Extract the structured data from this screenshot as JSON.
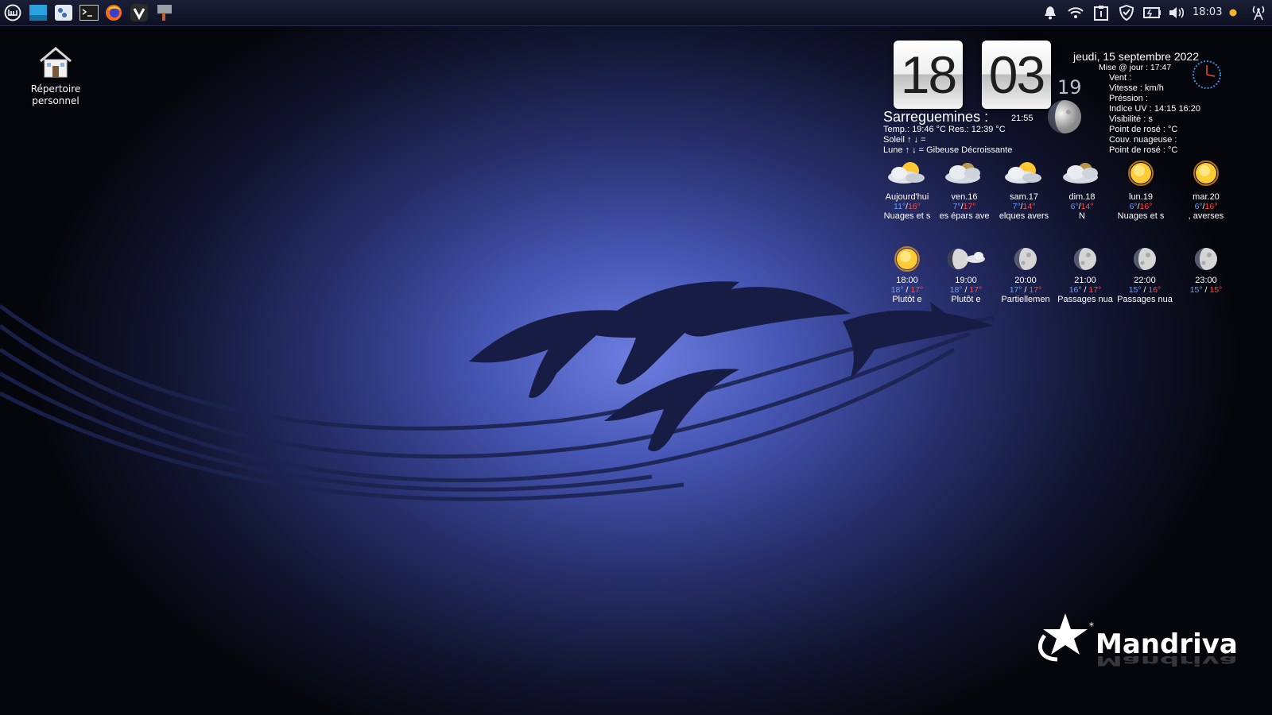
{
  "panel": {
    "launchers": [
      "mint-menu-icon",
      "show-desktop-icon",
      "settings-icon",
      "terminal-icon",
      "firefox-icon",
      "vivaldi-icon",
      "app-icon"
    ],
    "tray": [
      "bell-icon",
      "wifi-icon",
      "clipboard-icon",
      "shield-icon",
      "battery-icon",
      "volume-icon"
    ],
    "clock": "18:03"
  },
  "desktop": {
    "home_label_1": "Répertoire",
    "home_label_2": "personnel"
  },
  "widget": {
    "hour": "18",
    "minute": "03",
    "seconds": "19",
    "date": "jeudi, 15 septembre 2022",
    "update": "Mise @ jour : 17:47",
    "city": "Sarreguemines :",
    "city_time": "21:55",
    "temp_line": "Temp.: 19:46 °C   Res.: 12:39 °C",
    "sun_line": "Soleil ↑  ↓  =",
    "moon_line": "Lune  ↑  ↓  =  Gibeuse Décroissante",
    "stats": [
      "Vent :",
      "Vitesse :  km/h",
      "Préssion :",
      "Indice UV : 14:15 16:20",
      "Visibilité  : s",
      "Point de rosé :  °C",
      "Couv. nuageuse :",
      "Point de rosé :  °C"
    ],
    "daily": [
      {
        "label": "Aujourd'hui",
        "lo": "11°",
        "hi": "16°",
        "desc": "Nuages et s",
        "icon": "partly-cloudy-icon"
      },
      {
        "label": "ven.16",
        "lo": "7°",
        "hi": "17°",
        "desc": "es épars ave",
        "icon": "cloudy-icon"
      },
      {
        "label": "sam.17",
        "lo": "7°",
        "hi": "14°",
        "desc": "elques avers",
        "icon": "partly-cloudy-icon"
      },
      {
        "label": "dim.18",
        "lo": "6°",
        "hi": "14°",
        "desc": "N",
        "icon": "cloudy-icon"
      },
      {
        "label": "lun.19",
        "lo": "6°",
        "hi": "16°",
        "desc": "Nuages et s",
        "icon": "sun-icon"
      },
      {
        "label": "mar.20",
        "lo": "6°",
        "hi": "16°",
        "desc": ", averses",
        "icon": "sun-icon"
      }
    ],
    "hourly": [
      {
        "label": "18:00",
        "lo": "18°",
        "hi": "17°",
        "desc": "Plutôt e",
        "icon": "sun-icon"
      },
      {
        "label": "19:00",
        "lo": "18°",
        "hi": "17°",
        "desc": "Plutôt e",
        "icon": "moon-cloud-icon"
      },
      {
        "label": "20:00",
        "lo": "17°",
        "hi": "17°",
        "desc": "Partiellemen",
        "icon": "moon-icon"
      },
      {
        "label": "21:00",
        "lo": "16°",
        "hi": "17°",
        "desc": "Passages nua",
        "icon": "moon-icon"
      },
      {
        "label": "22:00",
        "lo": "15°",
        "hi": "16°",
        "desc": "Passages nua",
        "icon": "moon-icon"
      },
      {
        "label": "23:00",
        "lo": "15°",
        "hi": "15°",
        "desc": "",
        "icon": "moon-icon"
      }
    ]
  },
  "brand": "Mandriva",
  "colors": {
    "accent_blue": "#4f64d6",
    "low_temp": "#6a9cff",
    "high_temp": "#ff4a4a"
  }
}
